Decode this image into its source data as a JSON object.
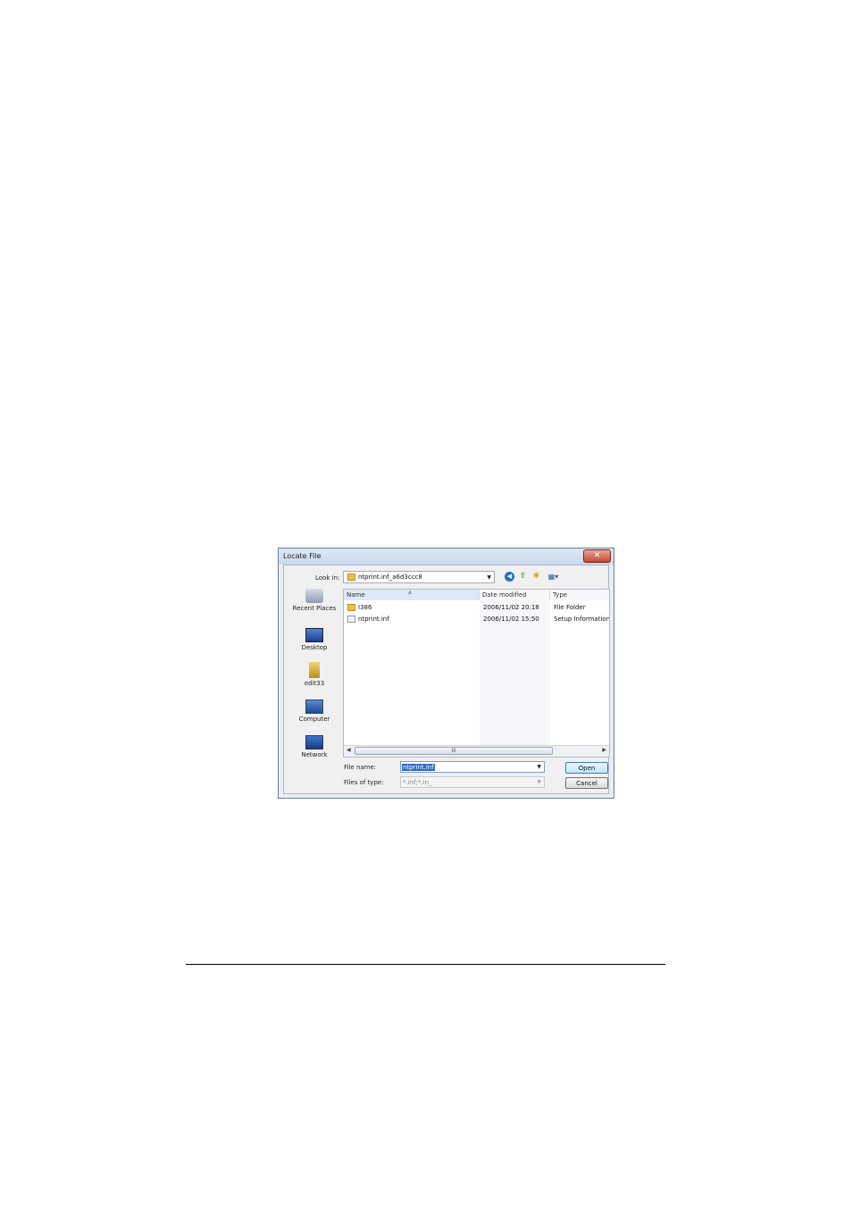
{
  "dialog": {
    "title": "Locate File",
    "close_glyph": "✕",
    "look_in_label": "Look in:",
    "look_in_value": "ntprint.inf_a6d3ccc8",
    "toolbar": {
      "back_icon": "back-icon",
      "up_icon": "up-folder-icon",
      "new_folder_icon": "new-folder-icon",
      "views_icon": "views-menu-icon"
    },
    "places": [
      {
        "label": "Recent Places",
        "icon": "recent-places-icon"
      },
      {
        "label": "Desktop",
        "icon": "desktop-icon"
      },
      {
        "label": "edit33",
        "icon": "user-folder-icon"
      },
      {
        "label": "Computer",
        "icon": "computer-icon"
      },
      {
        "label": "Network",
        "icon": "network-icon"
      }
    ],
    "columns": [
      "Name",
      "Date modified",
      "Type"
    ],
    "files": [
      {
        "name": "I386",
        "date": "2006/11/02 20:18",
        "type": "File Folder",
        "icon": "folder-icon"
      },
      {
        "name": "ntprint.inf",
        "date": "2006/11/02 15:50",
        "type": "Setup Information",
        "icon": "setup-file-icon"
      }
    ],
    "scrollbar_grip": "III",
    "file_name_label": "File name:",
    "file_name_value": "ntprint.inf",
    "files_of_type_label": "Files of type:",
    "files_of_type_value": "*.inf;*.in_",
    "open_label": "Open",
    "cancel_label": "Cancel"
  }
}
